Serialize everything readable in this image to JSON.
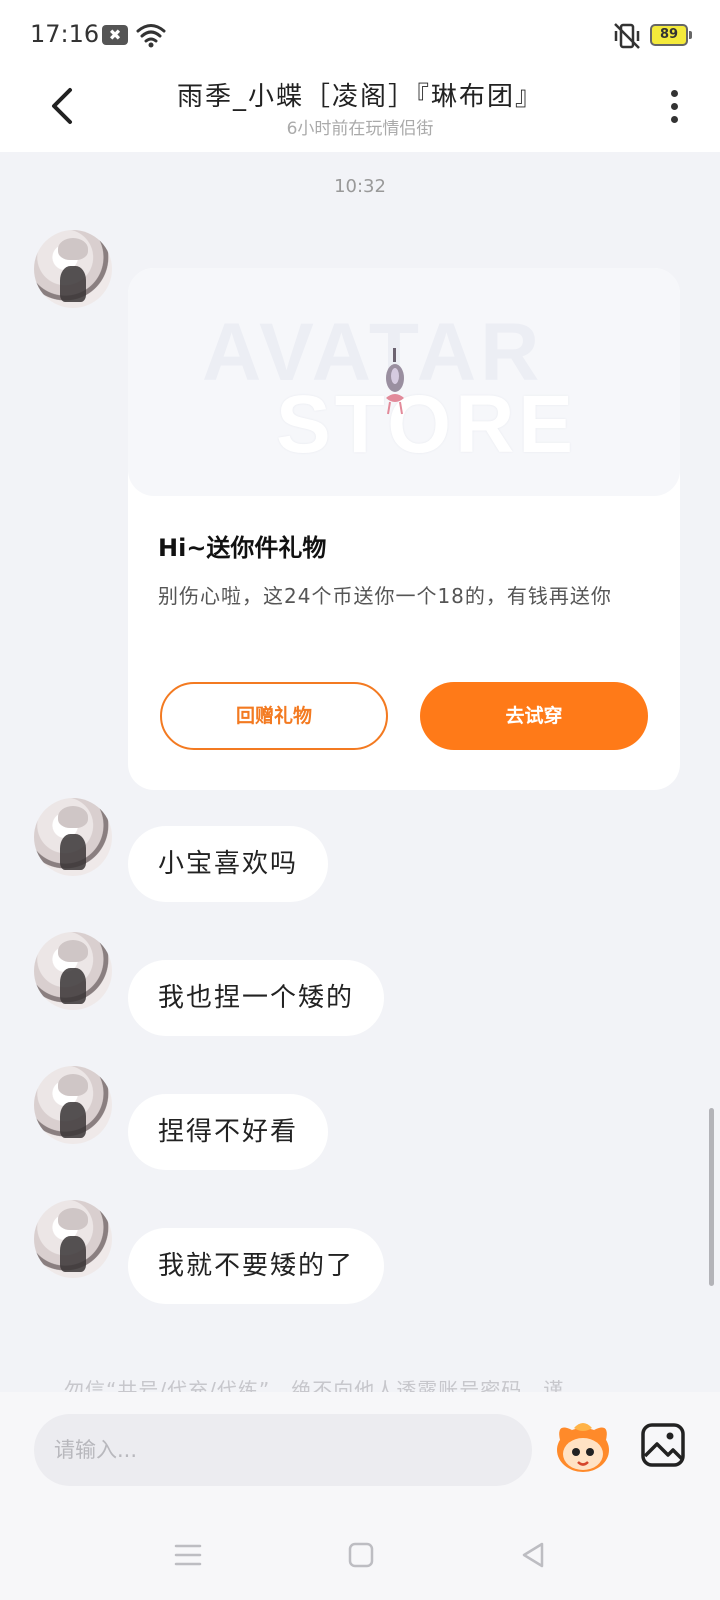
{
  "status_bar": {
    "time": "17:16",
    "app_icon_glyph": "✖",
    "battery": "89",
    "icons": [
      "wifi-icon",
      "vibrate-mute-icon",
      "battery-icon"
    ]
  },
  "header": {
    "title": "雨季_小蝶［凌阁］『琳布团』",
    "subtitle": "6小时前在玩情侣街",
    "back_icon": "chevron-left-icon",
    "more_icon": "more-vertical-icon"
  },
  "chat": {
    "timestamp": "10:32",
    "gift_card": {
      "banner_line_1": "AVATAR",
      "banner_line_2": "STORE",
      "title": "Hi~送你件礼物",
      "description": "别伤心啦，这24个币送你一个18的，有钱再送你",
      "return_gift_label": "回赠礼物",
      "try_on_label": "去试穿",
      "accent_color": "#ff7a18"
    },
    "messages": [
      {
        "text": "小宝喜欢吗"
      },
      {
        "text": "我也捏一个矮的"
      },
      {
        "text": "捏得不好看"
      },
      {
        "text": "我就不要矮的了"
      }
    ],
    "notice": "勿信“共号/代充/代练”，绝不向他人透露账号密码，谨"
  },
  "input_bar": {
    "placeholder": "请输入...",
    "icons": [
      "mascot-sticker-icon",
      "image-icon"
    ]
  },
  "nav_bar": {
    "icons": [
      "menu-icon",
      "home-square-icon",
      "back-triangle-icon"
    ]
  }
}
